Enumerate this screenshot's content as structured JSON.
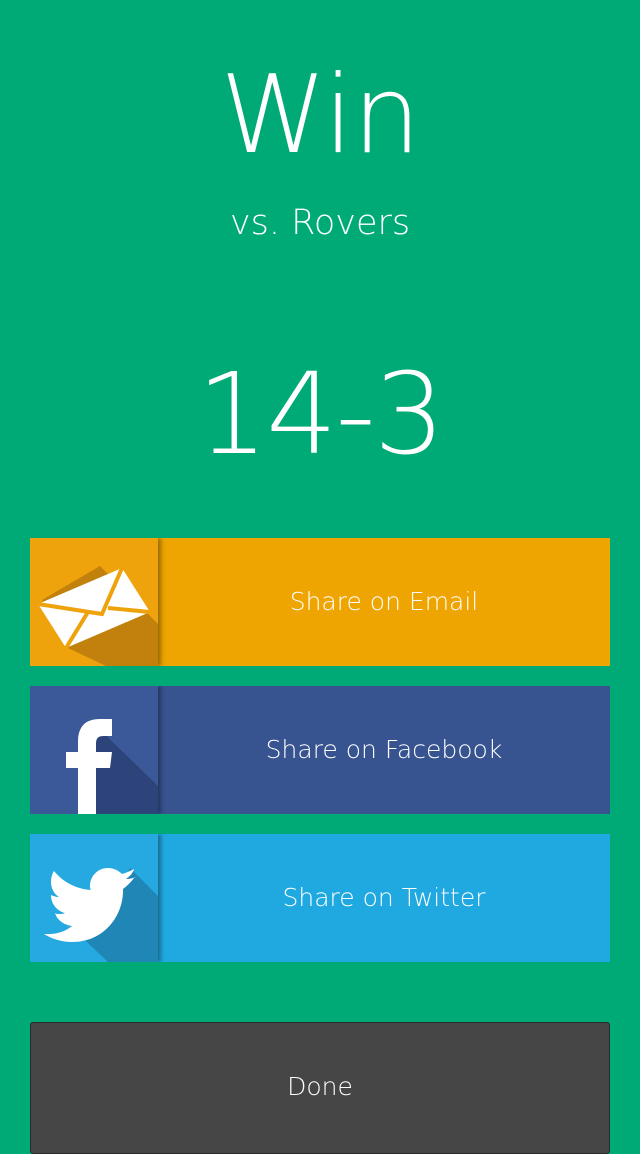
{
  "result": {
    "title": "Win",
    "opponent": "vs. Rovers",
    "score": "14-3"
  },
  "share": [
    {
      "label": "Share on Email",
      "icon": "envelope-icon",
      "color": "#eea501"
    },
    {
      "label": "Share on Facebook",
      "icon": "facebook-icon",
      "color": "#375491"
    },
    {
      "label": "Share on Twitter",
      "icon": "twitter-bird-icon",
      "color": "#20a9e0"
    }
  ],
  "actions": {
    "done_label": "Done"
  },
  "colors": {
    "background": "#00aa76",
    "done_button": "#464646"
  }
}
